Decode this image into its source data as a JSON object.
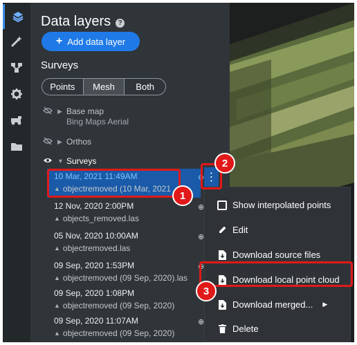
{
  "panel": {
    "title": "Data layers",
    "add_label": "Add data layer",
    "surveys_heading": "Surveys",
    "view_modes": [
      "Points",
      "Mesh",
      "Both"
    ],
    "selected_view_mode": "Mesh"
  },
  "layers": [
    {
      "label": "Base map",
      "sub": "Bing Maps Aerial",
      "visible": false,
      "expanded": false
    },
    {
      "label": "Orthos",
      "visible": false,
      "expanded": false
    },
    {
      "label": "Surveys",
      "visible": true,
      "expanded": true
    }
  ],
  "surveys": [
    {
      "date": "10 Mar, 2021 11:49AM",
      "file": "objectremoved (10 Mar, 2021",
      "selected": true
    },
    {
      "date": "12 Nov, 2020 2:00PM",
      "file": "objects_removed.las",
      "selected": false
    },
    {
      "date": "05 Nov, 2020 10:00AM",
      "file": "objectremoved.las",
      "selected": false
    },
    {
      "date": "09 Sep, 2020 1:53PM",
      "file": "objectremoved (09 Sep, 2020).las",
      "selected": false
    },
    {
      "date": "09 Sep, 2020 1:08PM",
      "file": "objectremoved (09 Sep, 2020)",
      "selected": false
    },
    {
      "date": "09 Sep, 2020 11:07AM",
      "file": "objectremoved (09 Sep, 2020)",
      "selected": false
    }
  ],
  "menu": {
    "show_interpolated": "Show interpolated points",
    "edit": "Edit",
    "download_source": "Download source files",
    "download_local": "Download local point cloud",
    "download_merged": "Download merged...",
    "delete": "Delete"
  },
  "callouts": {
    "one": "1",
    "two": "2",
    "three": "3"
  },
  "colors": {
    "accent": "#1f7ae8",
    "selected_row": "#1a5aa8",
    "callout": "#e11919",
    "panel": "#30353a"
  },
  "icons": {
    "rail": [
      "layers-icon",
      "magic-wand-icon",
      "hierarchy-icon",
      "settings-gear-icon",
      "truck-icon",
      "folder-icon"
    ],
    "menu": [
      "checkbox-icon",
      "pencil-icon",
      "file-download-icon",
      "file-download-icon",
      "file-download-icon",
      "trash-icon"
    ]
  }
}
